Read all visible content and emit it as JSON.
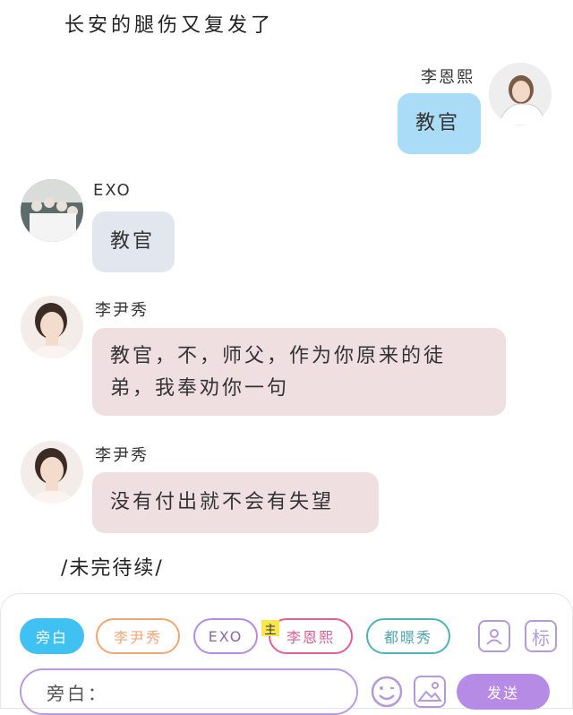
{
  "narration_top": "长安的腿伤又复发了",
  "messages": [
    {
      "speaker": "李恩熙",
      "text": "教官"
    },
    {
      "speaker": "EXO",
      "text": "教官"
    },
    {
      "speaker": "李尹秀",
      "text_line1": "教官，不，师父，作为你原来的徒",
      "text_line2": "弟，我奉劝你一句"
    },
    {
      "speaker": "李尹秀",
      "text": "没有付出就不会有失望"
    }
  ],
  "narration_bottom": "/未完待续/",
  "composer": {
    "chips": [
      "旁白",
      "李尹秀",
      "EXO",
      "李恩熙",
      "都暻秀"
    ],
    "main_badge": "主",
    "tag_button": "标",
    "input_value": "旁白：",
    "send_label": "发送"
  },
  "colors": {
    "bubble_blue": "#abdcf7",
    "bubble_gray": "#e1e6ef",
    "bubble_pink": "#f0dfe0",
    "accent_purple": "#b58be6",
    "chip_active": "#3fc1f2"
  },
  "icons": [
    "user-card-icon",
    "emoji-icon",
    "image-icon"
  ]
}
